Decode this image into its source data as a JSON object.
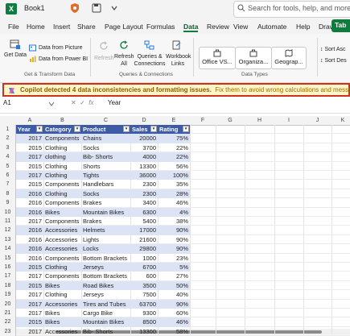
{
  "titlebar": {
    "book": "Book1",
    "search_placeholder": "Search for tools, help, and more (Alt"
  },
  "menu": [
    "File",
    "Home",
    "Insert",
    "Share",
    "Page Layout",
    "Formulas",
    "Data",
    "Review",
    "View",
    "Automate",
    "Help",
    "Draw",
    "Tab"
  ],
  "ribbon": {
    "get_data": "Get Data",
    "from_picture": "Data from Picture",
    "from_powerbi": "Data from Power BI",
    "group1": "Get & Transform Data",
    "refresh": "Refresh",
    "refresh_all": "Refresh All",
    "queries": "Queries & Connections",
    "workbook_links": "Workbook Links",
    "group2": "Queries & Connections",
    "dtypes": [
      "Office VS...",
      "Organiza...",
      "Geograp..."
    ],
    "group3": "Data Types",
    "sort_asc": "Sort Asc",
    "sort_desc": "Sort Des"
  },
  "copilot": {
    "bold": "Copilot detected 4 data inconsistencies and formatting issues.",
    "rest": "Fix them to avoid wrong calculations and messy wor"
  },
  "formula": {
    "cell": "A1",
    "fx": "fx",
    "value": "Year"
  },
  "columns": [
    "A",
    "B",
    "C",
    "D",
    "E",
    "F",
    "G",
    "H",
    "I",
    "J",
    "K"
  ],
  "table": {
    "headers": [
      "Year",
      "Category",
      "Product",
      "Sales",
      "Rating"
    ],
    "rows": [
      [
        "2017",
        "Components",
        "Chains",
        "20000",
        "75%"
      ],
      [
        "2015",
        "Clothing",
        "Socks",
        "3700",
        "22%"
      ],
      [
        "2017",
        "clothing",
        "Bib-  Shorts",
        "4000",
        "22%"
      ],
      [
        "2015",
        "Clothing",
        "Shorts",
        "13300",
        "56%"
      ],
      [
        "2017",
        "Clothing",
        "Tights",
        "36000",
        "100%"
      ],
      [
        "2015",
        "Components",
        "Handlebars",
        "2300",
        "35%"
      ],
      [
        "2016",
        "Clothing",
        "Socks",
        "2300",
        "28%"
      ],
      [
        "2016",
        "Components",
        "Brakes",
        "3400",
        "46%"
      ],
      [
        "2016",
        "Bikes",
        "Mountain Bikes",
        "6300",
        "4%"
      ],
      [
        "2017",
        "Components",
        "Brakes",
        "5400",
        "38%"
      ],
      [
        "2016",
        "Accessories",
        "Helmets",
        "17000",
        "90%"
      ],
      [
        "2016",
        "Accessories",
        "Lights",
        "21600",
        "90%"
      ],
      [
        "2016",
        "Accessories",
        "Locks",
        "29800",
        "90%"
      ],
      [
        "2016",
        "Components",
        "Bottom Brackets",
        "1000",
        "23%"
      ],
      [
        "2015",
        "Clothing",
        "Jerseys",
        "6700",
        "5%"
      ],
      [
        "2017",
        "Components",
        "Bottom Brackets",
        "600",
        "27%"
      ],
      [
        "2015",
        "Bikes",
        "Road Bikes",
        "3500",
        "50%"
      ],
      [
        "2017",
        "Clothing",
        "Jerseys",
        "7500",
        "40%"
      ],
      [
        "2017",
        "Accessories",
        "Tires and Tubes",
        "63700",
        "90%"
      ],
      [
        "2017",
        "Bikes",
        "Cargo Bike",
        "9300",
        "60%"
      ],
      [
        "2015",
        "Bikes",
        "Mountain Bikes",
        "8500",
        "46%"
      ],
      [
        "2017",
        "Accessories",
        "Bib- Shorts",
        "13300",
        "58%"
      ]
    ]
  }
}
